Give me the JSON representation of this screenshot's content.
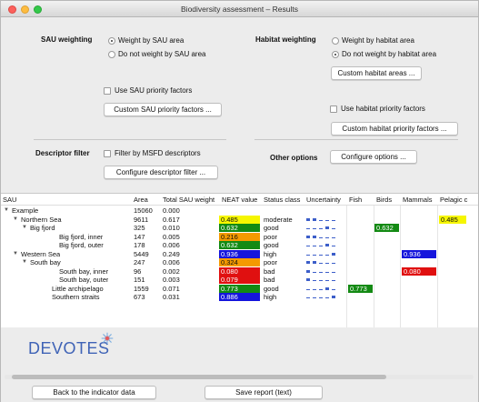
{
  "window": {
    "title": "Biodiversity assessment – Results"
  },
  "sau_weighting": {
    "label": "SAU weighting",
    "options": [
      "Weight by SAU area",
      "Do not weight by SAU area"
    ],
    "selected": 0,
    "priority_checkbox": "Use SAU priority factors",
    "custom_button": "Custom SAU priority factors ..."
  },
  "habitat_weighting": {
    "label": "Habitat weighting",
    "options": [
      "Weight by habitat area",
      "Do not weight by habitat area"
    ],
    "selected": 1,
    "custom_areas_button": "Custom habitat areas ...",
    "priority_checkbox": "Use habitat priority factors",
    "custom_priority_button": "Custom habitat priority factors ..."
  },
  "descriptor_filter": {
    "label": "Descriptor filter",
    "checkbox": "Filter by MSFD descriptors",
    "configure_button": "Configure descriptor filter ..."
  },
  "other_options": {
    "label": "Other options",
    "configure_button": "Configure options ..."
  },
  "table": {
    "headers": [
      "SAU",
      "Area",
      "Total SAU weight",
      "NEAT value",
      "Status class",
      "Uncertainty",
      "Fish",
      "Birds",
      "Mammals",
      "Pelagic c"
    ],
    "rows": [
      {
        "name": "Example",
        "indent": 0,
        "expander": "down",
        "area": "15060",
        "weight": "0.000",
        "neat": "",
        "status": "",
        "unc": [],
        "fish": "",
        "birds": "",
        "mammals": "",
        "pelagic": ""
      },
      {
        "name": "Northern Sea",
        "indent": 1,
        "expander": "down",
        "area": "9611",
        "weight": "0.617",
        "neat": "0.485",
        "status": "moderate",
        "unc": [
          1,
          1,
          0,
          0,
          0
        ],
        "fish": "",
        "birds": "",
        "mammals": "",
        "pelagic": "0.485"
      },
      {
        "name": "Big fjord",
        "indent": 2,
        "expander": "down",
        "area": "325",
        "weight": "0.010",
        "neat": "0.632",
        "status": "good",
        "unc": [
          0,
          0,
          0,
          1,
          0
        ],
        "fish": "",
        "birds": "0.632",
        "mammals": "",
        "pelagic": ""
      },
      {
        "name": "Big fjord, inner",
        "indent": 3,
        "expander": "",
        "area": "147",
        "weight": "0.005",
        "neat": "0.216",
        "status": "poor",
        "unc": [
          1,
          1,
          0,
          0,
          0
        ],
        "fish": "",
        "birds": "",
        "mammals": "",
        "pelagic": ""
      },
      {
        "name": "Big fjord, outer",
        "indent": 3,
        "expander": "",
        "area": "178",
        "weight": "0.006",
        "neat": "0.632",
        "status": "good",
        "unc": [
          0,
          0,
          0,
          1,
          0
        ],
        "fish": "",
        "birds": "",
        "mammals": "",
        "pelagic": ""
      },
      {
        "name": "Western Sea",
        "indent": 1,
        "expander": "down",
        "area": "5449",
        "weight": "0.249",
        "neat": "0.936",
        "status": "high",
        "unc": [
          0,
          0,
          0,
          0,
          1
        ],
        "fish": "",
        "birds": "",
        "mammals": "0.936",
        "pelagic": ""
      },
      {
        "name": "South bay",
        "indent": 2,
        "expander": "down",
        "area": "247",
        "weight": "0.006",
        "neat": "0.324",
        "status": "poor",
        "unc": [
          1,
          1,
          0,
          0,
          0
        ],
        "fish": "",
        "birds": "",
        "mammals": "",
        "pelagic": ""
      },
      {
        "name": "South bay, inner",
        "indent": 3,
        "expander": "",
        "area": "96",
        "weight": "0.002",
        "neat": "0.080",
        "status": "bad",
        "unc": [
          1,
          0,
          0,
          0,
          0
        ],
        "fish": "",
        "birds": "",
        "mammals": "0.080",
        "pelagic": ""
      },
      {
        "name": "South bay, outer",
        "indent": 3,
        "expander": "",
        "area": "151",
        "weight": "0.003",
        "neat": "0.079",
        "status": "bad",
        "unc": [
          1,
          0,
          0,
          0,
          0
        ],
        "fish": "",
        "birds": "",
        "mammals": "",
        "pelagic": ""
      },
      {
        "name": "Little archipelago",
        "indent": 2,
        "expander": "",
        "area": "1559",
        "weight": "0.071",
        "neat": "0.773",
        "status": "good",
        "unc": [
          0,
          0,
          0,
          1,
          0
        ],
        "fish": "0.773",
        "birds": "",
        "mammals": "",
        "pelagic": ""
      },
      {
        "name": "Southern straits",
        "indent": 2,
        "expander": "",
        "area": "673",
        "weight": "0.031",
        "neat": "0.886",
        "status": "high",
        "unc": [
          0,
          0,
          0,
          0,
          1
        ],
        "fish": "",
        "birds": "",
        "mammals": "",
        "pelagic": ""
      }
    ]
  },
  "status_colors": {
    "high": "#1515dc",
    "good": "#138a13",
    "moderate": "#f6f600",
    "poor": "#f49a00",
    "bad": "#e01010"
  },
  "uncertainty_color": "#3c5ec9",
  "logo": {
    "text": "DEVOTES"
  },
  "buttons": {
    "back": "Back to the indicator data",
    "save": "Save report (text)"
  }
}
